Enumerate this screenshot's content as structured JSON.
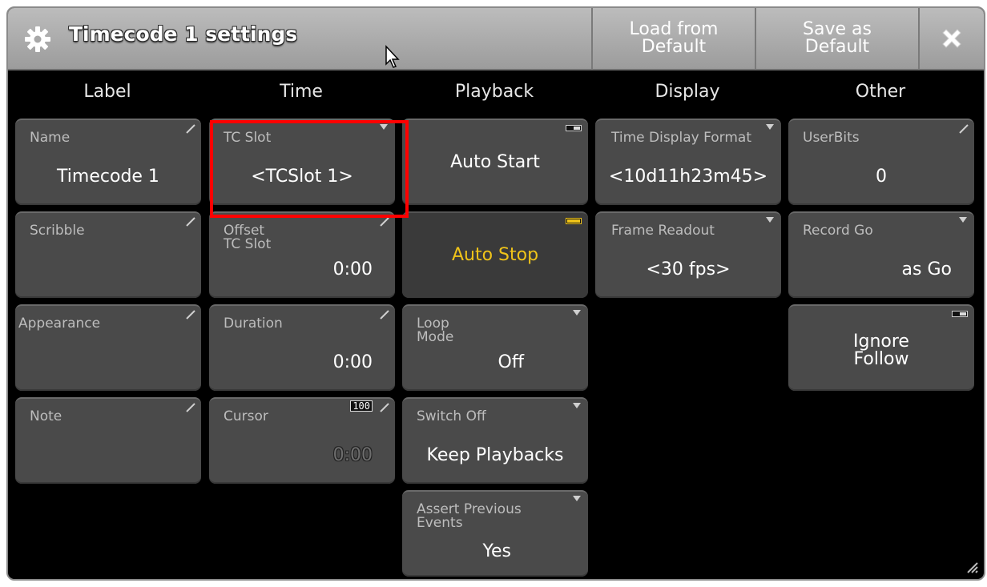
{
  "window": {
    "title": "Timecode 1 settings",
    "load_default_label": "Load from\nDefault",
    "save_default_label": "Save as\nDefault",
    "icons": {
      "settings": "gear-icon",
      "close": "close-icon",
      "cursor": "cursor-arrow-icon"
    }
  },
  "columns": [
    "Label",
    "Time",
    "Playback",
    "Display",
    "Other"
  ],
  "cells": {
    "name": {
      "label": "Name",
      "value": "Timecode 1"
    },
    "scribble": {
      "label": "Scribble",
      "value": ""
    },
    "appearance": {
      "label": "Appearance",
      "value": ""
    },
    "note": {
      "label": "Note",
      "value": ""
    },
    "tc_slot": {
      "label": "TC Slot",
      "value": "<TCSlot 1>"
    },
    "offset_tc_slot": {
      "label": "Offset\nTC Slot",
      "value": "0:00"
    },
    "duration": {
      "label": "Duration",
      "value": "0:00"
    },
    "cursor": {
      "label": "Cursor",
      "value": "0:00",
      "badge": "100"
    },
    "auto_start": {
      "value": "Auto Start",
      "state": "off"
    },
    "auto_stop": {
      "value": "Auto Stop",
      "state": "on"
    },
    "loop_mode": {
      "label": "Loop\nMode",
      "value": "Off"
    },
    "switch_off": {
      "label": "Switch Off",
      "value": "Keep Playbacks"
    },
    "assert_previous_events": {
      "label": "Assert Previous\nEvents",
      "value": "Yes"
    },
    "time_display_format": {
      "label": "Time Display Format",
      "value": "<10d11h23m45>"
    },
    "frame_readout": {
      "label": "Frame Readout",
      "value": "<30 fps>"
    },
    "userbits": {
      "label": "UserBits",
      "value": "0"
    },
    "record_go": {
      "label": "Record Go",
      "value": "as Go"
    },
    "ignore_follow": {
      "value": "Ignore\nFollow",
      "state": "off"
    }
  },
  "colors": {
    "highlight": "#ff0000",
    "active_text": "#f0c419",
    "cell_bg": "#4a4a4a",
    "window_bg": "#000000",
    "titlebar": "#ababab"
  }
}
